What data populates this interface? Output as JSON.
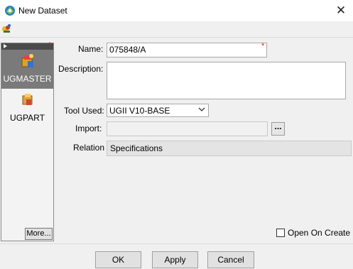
{
  "window": {
    "title": "New Dataset",
    "close_glyph": "✕"
  },
  "toolbar": {
    "icon": "wizard-icon"
  },
  "left_panel": {
    "items": [
      {
        "label": "UGMASTER",
        "icon": "ugmaster-icon",
        "selected": true
      },
      {
        "label": "UGPART",
        "icon": "ugpart-icon",
        "selected": false
      }
    ],
    "more_label": "More..."
  },
  "form": {
    "name_label": "Name:",
    "name_value": "075848/A",
    "description_label": "Description:",
    "description_value": "",
    "tool_label": "Tool Used:",
    "tool_value": "UGII V10-BASE",
    "import_label": "Import:",
    "import_value": "",
    "import_button": "...",
    "relation_label": "Relation",
    "relation_value": "Specifications",
    "required_marker": "*"
  },
  "open_on_create": {
    "label": "Open On Create",
    "checked": false
  },
  "buttons": {
    "ok": "OK",
    "apply": "Apply",
    "cancel": "Cancel"
  }
}
